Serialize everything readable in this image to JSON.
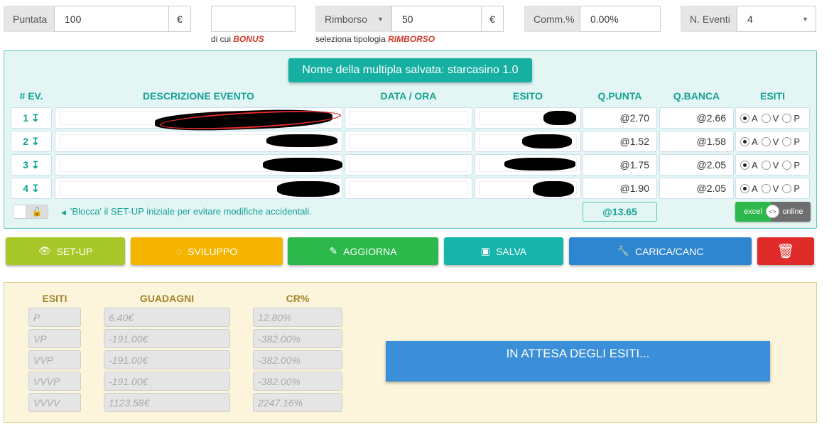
{
  "top": {
    "puntata_label": "Puntata",
    "puntata_value": "100",
    "currency": "€",
    "bonus_value": "",
    "bonus_sub_prefix": "di cui",
    "bonus_sub_em": "BONUS",
    "rimborso_label": "Rimborso",
    "rimborso_value": "50",
    "rimborso_sub_prefix": "seleziona tipologia",
    "rimborso_sub_em": "RIMBORSO",
    "comm_label": "Comm.%",
    "comm_value": "0.00%",
    "eventi_label": "N. Eventi",
    "eventi_value": "4"
  },
  "multipla": {
    "title": "Nome della multipla salvata: starcasino 1.0",
    "headers": [
      "# EV.",
      "DESCRIZIONE EVENTO",
      "DATA / ORA",
      "ESITO",
      "Q.PUNTA",
      "Q.BANCA",
      "ESITI"
    ],
    "rows": [
      {
        "num": "1",
        "q_punta": "@2.70",
        "q_banca": "@2.66"
      },
      {
        "num": "2",
        "q_punta": "@1.52",
        "q_banca": "@1.58"
      },
      {
        "num": "3",
        "q_punta": "@1.75",
        "q_banca": "@2.05"
      },
      {
        "num": "4",
        "q_punta": "@1.90",
        "q_banca": "@2.05"
      }
    ],
    "esiti_options": [
      "A",
      "V",
      "P"
    ],
    "esiti_selected": "A",
    "lock_hint": "'Blocca' il SET-UP iniziale per evitare modifiche accidentali.",
    "total_quota": "@13.65",
    "toggle_excel": "excel",
    "toggle_online": "online",
    "toggle_knob": "<>"
  },
  "buttons": {
    "setup": "SET-UP",
    "sviluppo": "SVILUPPO",
    "aggiorna": "AGGIORNA",
    "salva": "SALVA",
    "carica": "CARICA/CANC"
  },
  "results": {
    "headers": [
      "ESITI",
      "GUADAGNI",
      "CR%"
    ],
    "rows": [
      {
        "esito": "P",
        "guadagno": "6.40€",
        "cr": "12.80%"
      },
      {
        "esito": "VP",
        "guadagno": "-191.00€",
        "cr": "-382.00%"
      },
      {
        "esito": "VVP",
        "guadagno": "-191.00€",
        "cr": "-382.00%"
      },
      {
        "esito": "VVVP",
        "guadagno": "-191.00€",
        "cr": "-382.00%"
      },
      {
        "esito": "VVVV",
        "guadagno": "1123.58€",
        "cr": "2247.16%"
      }
    ],
    "waiting": "IN ATTESA DEGLI ESITI..."
  },
  "colors": {
    "teal": "#16b0a3",
    "setup": "#a8c82a",
    "sviluppo": "#f4b400",
    "aggiorna": "#2cb84a",
    "salva": "#16b4ab",
    "carica": "#2f86d0",
    "delete": "#e02b2b",
    "waiting": "#3a8fd8"
  }
}
